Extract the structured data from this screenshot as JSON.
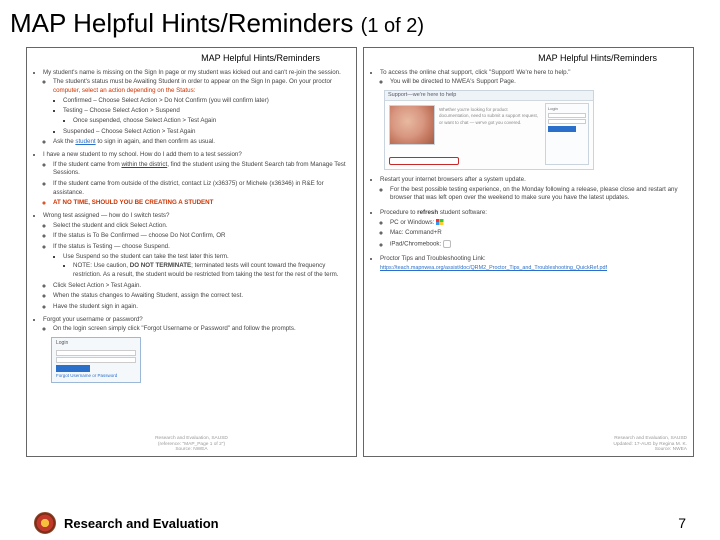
{
  "title": {
    "main": "MAP Helpful Hints/Reminders",
    "page_indicator": "(1 of 2)"
  },
  "footer": {
    "dept": "Research and Evaluation",
    "page_number": "7"
  },
  "left_slide": {
    "heading": "MAP Helpful Hints/Reminders",
    "b1": "My student's name is missing on the Sign In page or my student was kicked out and can't re-join the session.",
    "b1a": "The student's status must be Awaiting Student in order to appear on the Sign In page. On your proctor",
    "b1a2": "computer, select an action depending on the Status:",
    "b1a_i": "Confirmed – Choose Select Action > Do Not Confirm (you will confirm later)",
    "b1a_ii": "Testing – Choose Select Action > Suspend",
    "b1a_ii_1": "Once suspended, choose Select Action > Test Again",
    "b1a_iii": "Suspended – Choose Select Action > Test Again",
    "b1b_pre": "Ask the ",
    "b1b_link": "student",
    "b1b_post": " to sign in again, and then confirm as usual.",
    "b2": "I have a new student to my school. How do I add them to a test session?",
    "b2a_pre": "If the student came from ",
    "b2a_u": "within the district",
    "b2a_post": ", find the student using the Student Search tab from Manage Test Sessions.",
    "b2b": "If the student came from outside of the district, contact Liz (x36375) or Michele (x36346) in R&E for assistance.",
    "b2c": "AT NO TIME, SHOULD YOU BE CREATING A STUDENT",
    "b3": "Wrong test assigned — how do I switch tests?",
    "b3a": "Select the student and click Select Action.",
    "b3b": "If the status is To Be Confirmed — choose Do Not Confirm, OR",
    "b3c": "If the status is Testing — choose Suspend.",
    "b3c1_pre": "Use Suspend so the student can take the test later this term.",
    "b3c1a_pre": "NOTE: Use caution, ",
    "b3c1a_bold": "DO NOT TERMINATE",
    "b3c1a_post": "; terminated tests will count toward the frequency restriction. As a result, the student would be restricted from taking the test for the rest of the term.",
    "b3d": "Click Select Action > Test Again.",
    "b3e": "When the status changes to Awaiting Student, assign the correct test.",
    "b3f": "Have the student sign in again.",
    "b4": "Forgot your username or password?",
    "b4a": "On the login screen simply click \"Forgot Username or Password\" and follow the prompts.",
    "login": {
      "title": "Login",
      "forgot": "Forgot Username or Password"
    },
    "foot1": "Research and Evaluation, SAUSD",
    "foot2": "(reference: \"MAP_Page 1 of 2\")",
    "foot3": "Source: NWEA"
  },
  "right_slide": {
    "heading": "MAP Helpful Hints/Reminders",
    "b1": "To access the online chat support, click \"Support! We're here to help.\"",
    "b1a": "You will be directed to NWEA's Support Page.",
    "support_bar": "Support—we're here to help",
    "sup_login_t": "Login",
    "sup_txt": "Whether you're looking for product documentation, need to submit a support request, or want to chat — we've got you covered.",
    "b2": "Restart your internet browsers after a system update.",
    "b2a": "For the best possible testing experience, on the Monday following a release, please close and restart any browser that was left open over the weekend to make sure you have the latest updates.",
    "b3_pre": "Procedure to ",
    "b3_b": "refresh",
    "b3_post": " student software:",
    "b3a": "PC or Windows: ",
    "b3b": "Mac: Command+R",
    "b3c": "iPad/Chromebook: ",
    "b4": "Proctor Tips and Troubleshooting Link:",
    "b4a": "https://teach.mapnwea.org/assist/doc/QRM2_Proctor_Tips_and_Troubleshooting_QuickRef.pdf",
    "footr1": "Research and Evaluation, SAUSD",
    "footr2": "Updated: 17-AUG by Regina M. K.",
    "footr3": "Source: NWEA"
  }
}
